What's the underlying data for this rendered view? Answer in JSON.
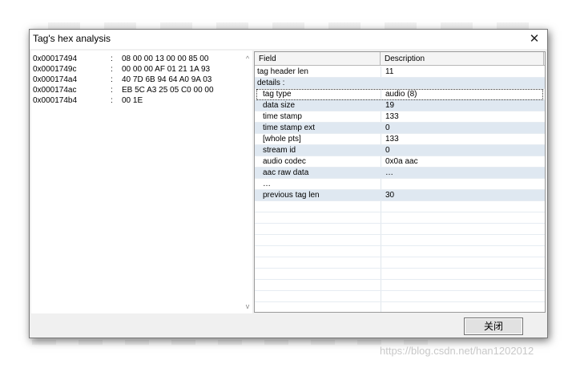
{
  "dialog": {
    "title": "Tag's hex analysis",
    "close_glyph": "✕",
    "close_button_label": "关闭"
  },
  "hex": {
    "rows": [
      {
        "addr": "0x00017494",
        "sep": ":",
        "bytes": "08 00 00 13 00 00 85 00"
      },
      {
        "addr": "0x0001749c",
        "sep": ":",
        "bytes": "00 00 00 AF 01 21 1A 93"
      },
      {
        "addr": "0x000174a4",
        "sep": ":",
        "bytes": "40 7D 6B 94 64 A0 9A 03"
      },
      {
        "addr": "0x000174ac",
        "sep": ":",
        "bytes": "EB 5C A3 25 05 C0 00 00"
      },
      {
        "addr": "0x000174b4",
        "sep": ":",
        "bytes": "00 1E"
      }
    ],
    "scroll_up": "^",
    "scroll_down": "v"
  },
  "grid": {
    "headers": {
      "field": "Field",
      "description": "Description"
    },
    "rows": [
      {
        "field": "tag header len",
        "description": "11",
        "indent": false,
        "alt": false
      },
      {
        "field": "details :",
        "description": "",
        "indent": false,
        "alt": true
      },
      {
        "field": "tag type",
        "description": "audio (8)",
        "indent": true,
        "alt": false,
        "focused": true
      },
      {
        "field": "data size",
        "description": "19",
        "indent": true,
        "alt": true
      },
      {
        "field": "time stamp",
        "description": "133",
        "indent": true,
        "alt": false
      },
      {
        "field": "time stamp ext",
        "description": "0",
        "indent": true,
        "alt": true
      },
      {
        "field": "[whole pts]",
        "description": "133",
        "indent": true,
        "alt": false
      },
      {
        "field": "stream id",
        "description": "0",
        "indent": true,
        "alt": true
      },
      {
        "field": "audio codec",
        "description": "0x0a  aac",
        "indent": true,
        "alt": false
      },
      {
        "field": "aac raw data",
        "description": "…",
        "indent": true,
        "alt": true
      },
      {
        "field": "…",
        "description": "",
        "indent": true,
        "alt": false
      },
      {
        "field": "previous tag len",
        "description": "30",
        "indent": true,
        "alt": true
      }
    ]
  },
  "watermark": "https://blog.csdn.net/han1202012"
}
